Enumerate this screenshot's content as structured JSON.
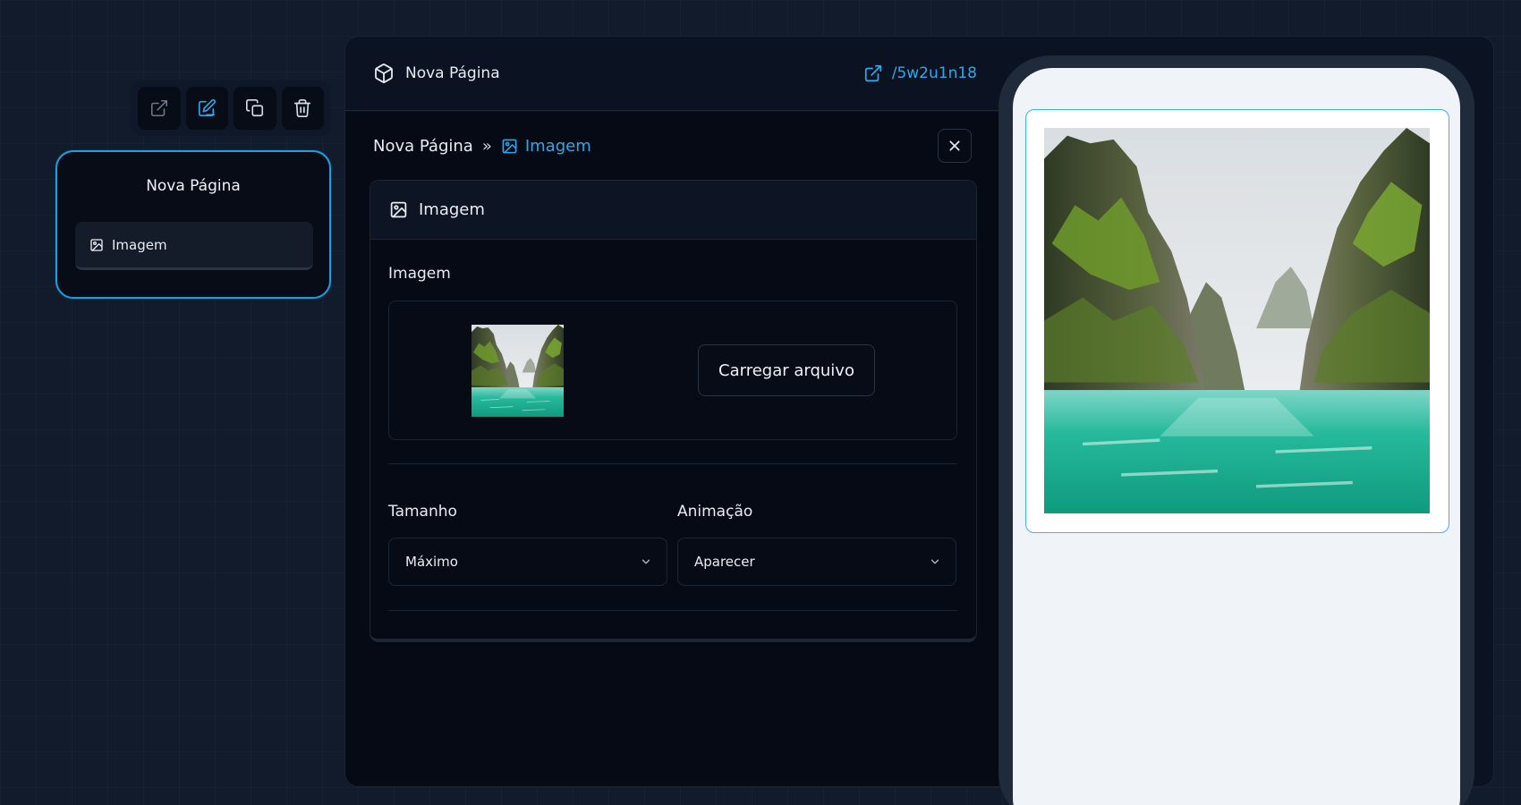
{
  "toolbar": {
    "buttons": [
      {
        "icon": "external-link-icon",
        "state": "muted"
      },
      {
        "icon": "edit-icon",
        "state": "active"
      },
      {
        "icon": "copy-icon",
        "state": "normal"
      },
      {
        "icon": "trash-icon",
        "state": "normal"
      }
    ]
  },
  "page_card": {
    "title": "Nova Página",
    "item_label": "Imagem",
    "item_icon": "image-icon"
  },
  "header": {
    "title": "Nova Página",
    "title_icon": "cube-icon",
    "link": "/5w2u1n18",
    "link_icon": "external-link-icon"
  },
  "breadcrumb": {
    "root": "Nova Página",
    "separator": "»",
    "current": "Imagem"
  },
  "section": {
    "title": "Imagem",
    "image_label": "Imagem",
    "upload_button": "Carregar arquivo",
    "size_label": "Tamanho",
    "size_value": "Máximo",
    "animation_label": "Animação",
    "animation_value": "Aparecer"
  },
  "colors": {
    "accent": "#2ea8e6",
    "background": "#111b2b",
    "panel": "#050a14"
  }
}
